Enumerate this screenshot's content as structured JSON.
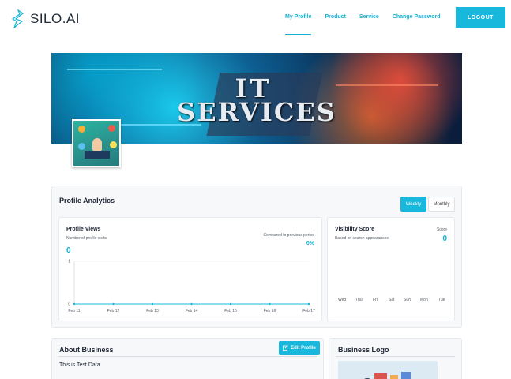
{
  "header": {
    "brand": "SILO.AI",
    "nav": [
      "My Profile",
      "Product",
      "Service",
      "Change Password"
    ],
    "active_nav": "My Profile",
    "logout_label": "LOGOUT"
  },
  "banner": {
    "line1": "IT",
    "line2": "SERVICES"
  },
  "analytics": {
    "title": "Profile Analytics",
    "weekly_label": "Weekly",
    "monthly_label": "Monthly",
    "selected_period": "Weekly",
    "views": {
      "title": "Profile Views",
      "subtitle": "Number of profile visits",
      "value": "0",
      "compare_label": "Compared to previous period",
      "compare_value": "0%"
    },
    "visibility": {
      "title": "Visibility Score",
      "subtitle": "Based on search appearances",
      "score_label": "Score",
      "value": "0",
      "days": [
        "Wed",
        "Thu",
        "Fri",
        "Sat",
        "Sun",
        "Mon",
        "Tue"
      ]
    }
  },
  "chart_data": {
    "type": "line",
    "x": [
      "Feb 11",
      "Feb 12",
      "Feb 13",
      "Feb 14",
      "Feb 15",
      "Feb 16",
      "Feb 17"
    ],
    "series": [
      {
        "values": [
          0,
          0,
          0,
          0,
          0,
          0,
          0
        ]
      }
    ],
    "ylim": [
      0,
      1
    ],
    "yticks": [
      "0",
      "1"
    ],
    "grid": true,
    "line_color": "#17b8dc"
  },
  "about": {
    "title": "About Business",
    "edit_label": "Edit Profile",
    "text": "This is Test Data"
  },
  "business_logo": {
    "title": "Business Logo"
  },
  "colors": {
    "accent": "#17b8dc",
    "text": "#1d2433"
  }
}
